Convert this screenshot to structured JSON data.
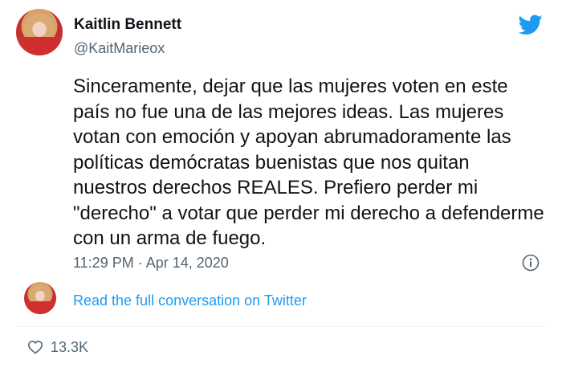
{
  "author": {
    "name": "Kaitlin Bennett",
    "handle": "@KaitMarieox"
  },
  "tweet": {
    "text": "Sinceramente, dejar que las mujeres voten en este país no fue una de las mejores ideas. Las mujeres votan con emoción y apoyan abrumadoramente las políticas demócratas buenistas que nos quitan nuestros derechos REALES. Prefiero perder mi \"derecho\" a votar que perder mi derecho a defenderme con un arma de fuego.",
    "timestamp": "11:29 PM · Apr 14, 2020"
  },
  "conversation": {
    "link_label": "Read the full conversation on Twitter"
  },
  "likes": {
    "count": "13.3K"
  },
  "colors": {
    "brand": "#1d9bf0",
    "text": "#0f1419",
    "muted": "#536471"
  },
  "icons": {
    "brand": "twitter-bird-icon",
    "info": "info-icon",
    "like": "heart-icon"
  }
}
